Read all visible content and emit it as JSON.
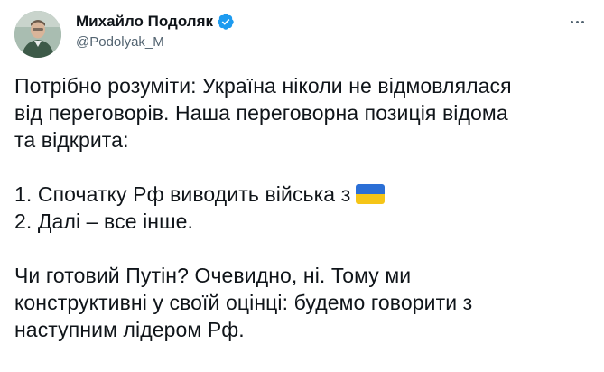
{
  "author": {
    "display_name": "Михайло Подоляк",
    "handle": "@Podolyak_M",
    "verified": true
  },
  "colors": {
    "text": "#0f1419",
    "secondary_text": "#536471",
    "verified_badge": "#1d9bf0",
    "flag_blue": "#2b6fd6",
    "flag_yellow": "#f5c518"
  },
  "tweet": {
    "para1": [
      "Потрібно розуміти: Україна ніколи не відмовлялася",
      "від переговорів. Наша переговорна позиція відома",
      "та відкрита:"
    ],
    "list": [
      "1. Спочатку Рф виводить війська з",
      "2. Далі – все інше."
    ],
    "flag_icon": "ukraine-flag-emoji",
    "para2": [
      "Чи готовий Путін? Очевидно, ні. Тому ми",
      "конструктивні у своїй оцінці: будемо говорити з",
      "наступним лідером Рф."
    ]
  }
}
